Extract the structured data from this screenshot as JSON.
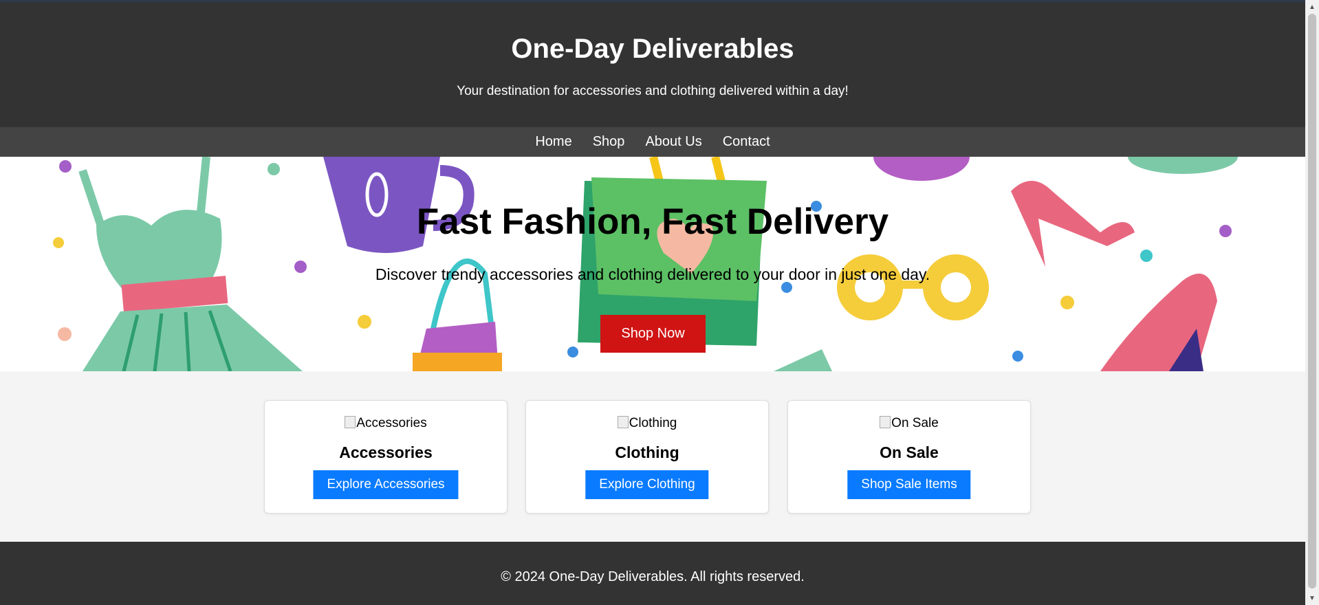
{
  "header": {
    "title": "One-Day Deliverables",
    "tagline": "Your destination for accessories and clothing delivered within a day!"
  },
  "nav": {
    "items": [
      {
        "label": "Home"
      },
      {
        "label": "Shop"
      },
      {
        "label": "About Us"
      },
      {
        "label": "Contact"
      }
    ]
  },
  "hero": {
    "title": "Fast Fashion, Fast Delivery",
    "subtitle": "Discover trendy accessories and clothing delivered to your door in just one day.",
    "button_label": "Shop Now"
  },
  "categories": [
    {
      "image_alt": "Accessories",
      "title": "Accessories",
      "button_label": "Explore Accessories"
    },
    {
      "image_alt": "Clothing",
      "title": "Clothing",
      "button_label": "Explore Clothing"
    },
    {
      "image_alt": "On Sale",
      "title": "On Sale",
      "button_label": "Shop Sale Items"
    }
  ],
  "footer": {
    "copyright": "© 2024 One-Day Deliverables. All rights reserved."
  },
  "colors": {
    "header_bg": "#333333",
    "nav_bg": "#444444",
    "cta_red": "#d01414",
    "button_blue": "#0a7bff"
  },
  "icons": {
    "scroll_up": "▲",
    "scroll_down": "▼"
  }
}
